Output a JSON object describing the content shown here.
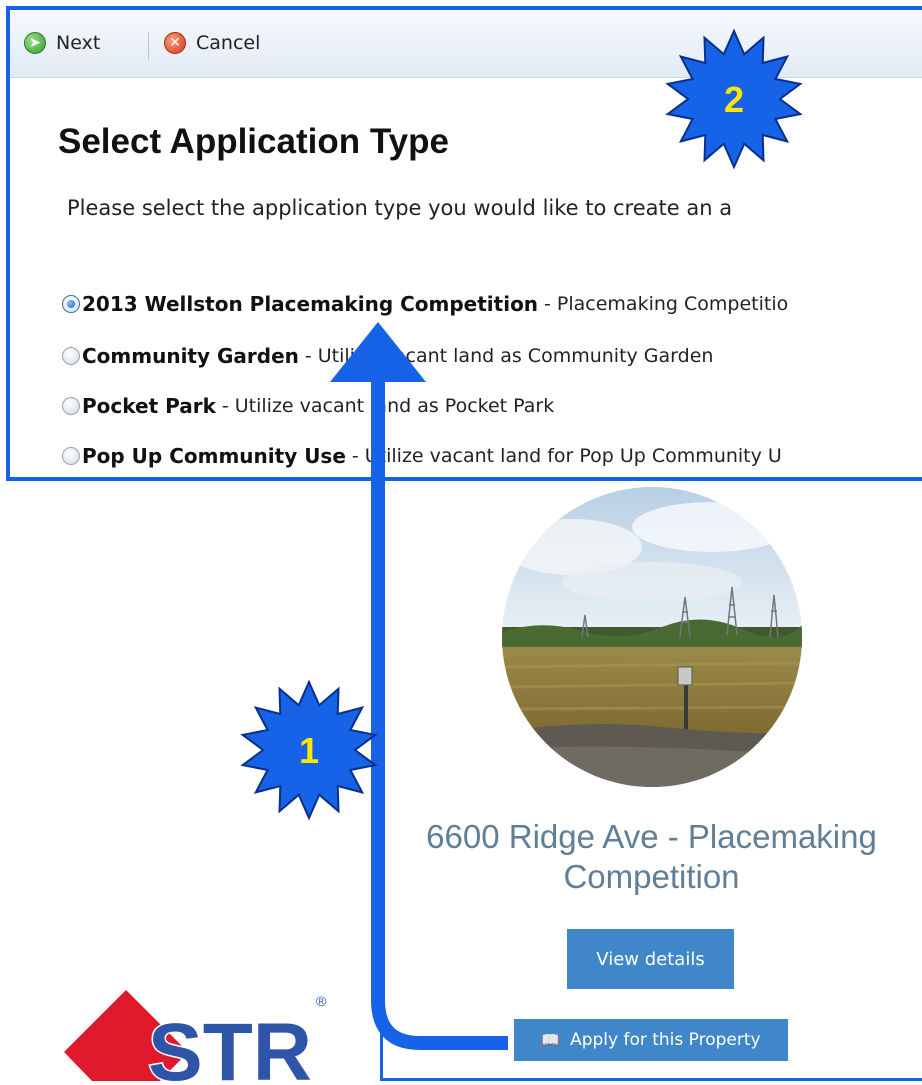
{
  "toolbar": {
    "next_label": "Next",
    "cancel_label": "Cancel"
  },
  "page": {
    "title": "Select Application Type",
    "instructions": "Please select the application type you would like to create an a"
  },
  "options": [
    {
      "name": "2013 Wellston Placemaking Competition",
      "description": "Placemaking Competitio",
      "selected": true
    },
    {
      "name": "Community Garden",
      "description": "Utilize vacant land as Community Garden",
      "selected": false
    },
    {
      "name": "Pocket Park",
      "description": "Utilize vacant land as Pocket Park",
      "selected": false
    },
    {
      "name": "Pop Up Community Use",
      "description": "Utilize vacant land for Pop Up Community U",
      "selected": false
    }
  ],
  "property": {
    "title_line1": "6600 Ridge Ave - Placemaking",
    "title_line2": "Competition",
    "view_details_label": "View details",
    "apply_label": "Apply for this Property"
  },
  "callouts": {
    "step1": "1",
    "step2": "2"
  },
  "logo": {
    "text": "STR",
    "registered_mark": "®"
  },
  "colors": {
    "frame_blue": "#1763e8",
    "button_blue": "#3f87c8",
    "callout_text": "#ffe600",
    "logo_red": "#e0192c"
  }
}
